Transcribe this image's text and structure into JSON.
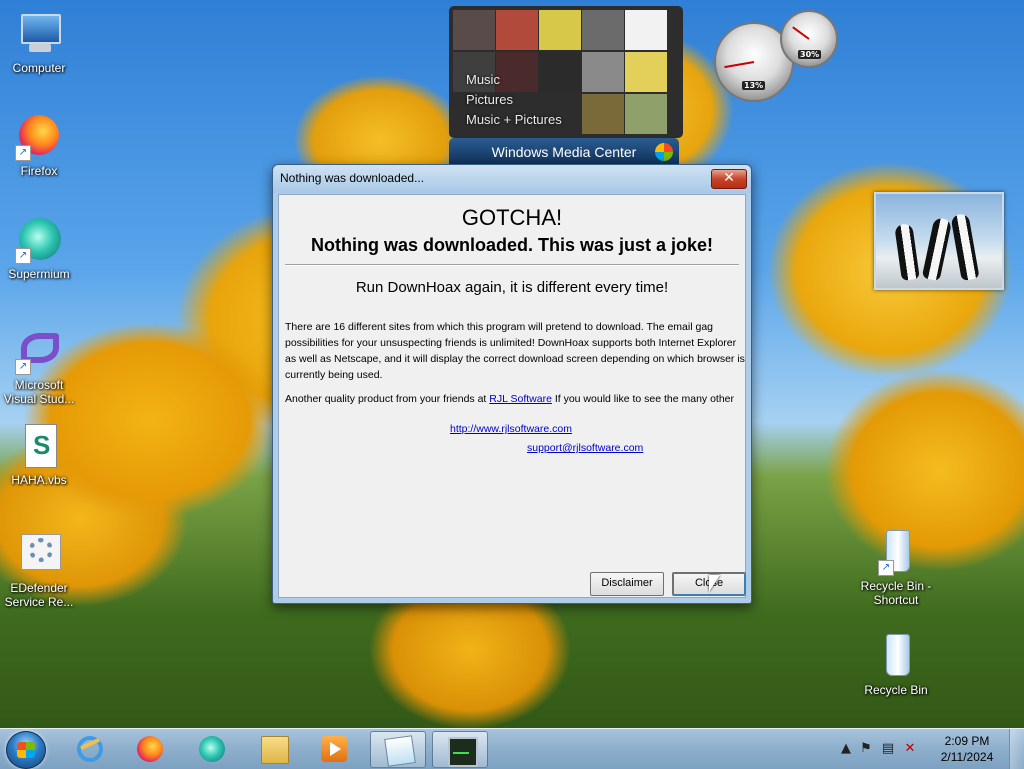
{
  "desktop": {
    "icons": [
      {
        "label": "Computer"
      },
      {
        "label": "Firefox"
      },
      {
        "label": "Supermium"
      },
      {
        "label": "Microsoft Visual Stud..."
      },
      {
        "label": "HAHA.vbs"
      },
      {
        "label": "EDefender Service Re..."
      },
      {
        "label": "Recycle Bin - Shortcut"
      },
      {
        "label": "Recycle Bin"
      }
    ]
  },
  "gadgets": {
    "media_center": {
      "menu": [
        "Music",
        "Pictures",
        "Music + Pictures"
      ],
      "title": "Windows Media Center"
    },
    "cpu_meter": {
      "cpu_percent": 13,
      "cpu_label": "13%",
      "memory_percent": 30,
      "memory_label": "30%"
    }
  },
  "dialog": {
    "title": "Nothing was downloaded...",
    "close_icon": "✕",
    "heading1": "GOTCHA!",
    "heading2": "Nothing was downloaded. This was just a joke!",
    "heading3": "Run DownHoax again, it is different every time!",
    "paragraph1": "There are 16 different sites from which this program will pretend to download. The email gag possibilities for your unsuspecting friends is unlimited!  DownHoax supports both Internet Explorer as well as Netscape, and it will display the correct download screen depending on which browser is currently being used.",
    "paragraph2_prefix": "Another quality product from your friends at ",
    "paragraph2_link": "RJL Software",
    "paragraph2_suffix": "  If you would like to see the many other",
    "url": "http://www.rjlsoftware.com",
    "email": "support@rjlsoftware.com",
    "disclaimer_button": "Disclaimer",
    "close_button": "Close"
  },
  "taskbar": {
    "pinned": [
      "start-orb",
      "internet-explorer-icon",
      "firefox-icon",
      "supermium-icon",
      "explorer-icon",
      "media-player-icon",
      "notepad-icon",
      "task-manager-icon"
    ],
    "clock_time": "2:09 PM",
    "clock_date": "2/11/2024"
  }
}
